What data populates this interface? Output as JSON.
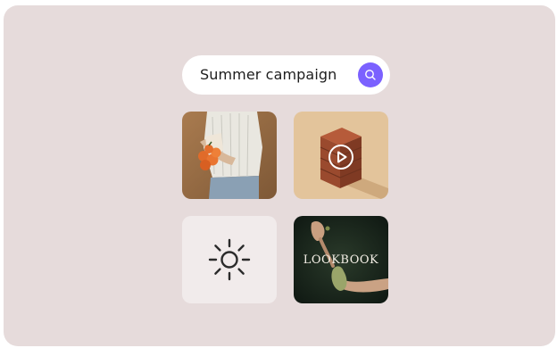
{
  "search": {
    "query": "Summer campaign",
    "button_icon": "search-icon",
    "accent_color": "#7b61ff"
  },
  "tiles": [
    {
      "type": "image",
      "subject": "person holding oranges",
      "icon": ""
    },
    {
      "type": "video",
      "subject": "stacked clay bricks",
      "icon": "play-icon"
    },
    {
      "type": "icon",
      "subject": "",
      "icon": "sun-icon"
    },
    {
      "type": "image",
      "subject": "hand holding pear",
      "label": "LOOKBOOK"
    }
  ],
  "colors": {
    "background": "#e6dbdb",
    "tile_light": "#f1ebeb"
  }
}
